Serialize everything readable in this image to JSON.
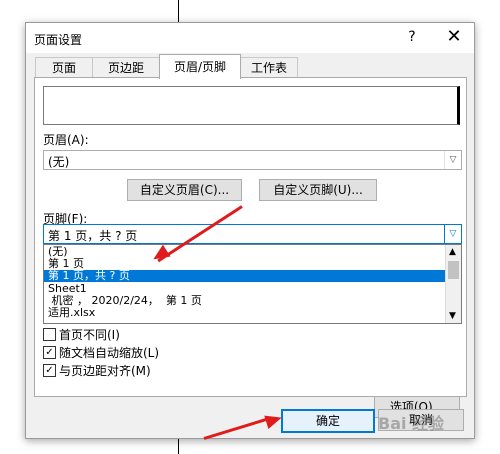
{
  "dialog": {
    "title": "页面设置",
    "help": "?",
    "close": "✕"
  },
  "tabs": [
    {
      "label": "页面",
      "active": false
    },
    {
      "label": "页边距",
      "active": false
    },
    {
      "label": "页眉/页脚",
      "active": true
    },
    {
      "label": "工作表",
      "active": false
    }
  ],
  "header": {
    "label": "页眉(A):",
    "value": "(无)"
  },
  "buttons": {
    "custom_header": "自定义页眉(C)...",
    "custom_footer": "自定义页脚(U)...",
    "options": "选项(O)...",
    "ok": "确定",
    "cancel": "取消"
  },
  "footer": {
    "label": "页脚(F):",
    "value": "第 1 页，共 ? 页",
    "options": [
      {
        "text": "(无)",
        "selected": false
      },
      {
        "text": "第 1 页",
        "selected": false
      },
      {
        "text": "第 1 页，共 ? 页",
        "selected": true
      },
      {
        "text": "Sheet1",
        "selected": false
      },
      {
        "text": " 机密 ， 2020/2/24，  第 1 页",
        "selected": false
      },
      {
        "text": "适用.xlsx",
        "selected": false
      }
    ]
  },
  "checkboxes": [
    {
      "label": "首页不同(I)",
      "checked": false
    },
    {
      "label": "随文档自动缩放(L)",
      "checked": true
    },
    {
      "label": "与页边距对齐(M)",
      "checked": true
    }
  ],
  "watermark": "Bai 经验",
  "colors": {
    "selection": "#0078d7",
    "arrow": "#e01b1b"
  }
}
